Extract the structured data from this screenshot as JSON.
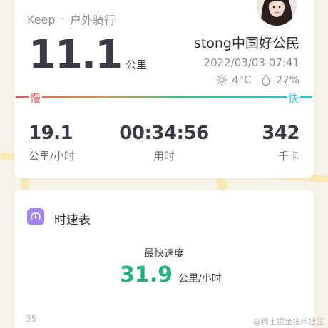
{
  "header": {
    "brand": "Keep",
    "separator": "·",
    "activity": "户外骑行"
  },
  "summary": {
    "distance": "11.1",
    "distance_unit": "公里",
    "username": "stong中国好公民",
    "datetime": "2022/03/03 07:41",
    "temperature": "4°C",
    "humidity": "27%"
  },
  "speed_legend": {
    "slow": "慢",
    "fast": "快"
  },
  "stats": [
    {
      "value": "19.1",
      "label": "公里/小时"
    },
    {
      "value": "00:34:56",
      "label": "用时"
    },
    {
      "value": "342",
      "label": "千卡"
    }
  ],
  "speedometer": {
    "title": "时速表",
    "fastest_label": "最快速度",
    "fastest_value": "31.9",
    "fastest_unit": "公里/小时",
    "axis_tick": "35"
  },
  "watermark": "@稀土掘金技术社区",
  "colors": {
    "accent_green": "#23b27a",
    "slow_red": "#e05a5a",
    "fast_cyan": "#2ec5d9",
    "icon_purple": "#9f86e8"
  },
  "icons": [
    "sun-icon",
    "humidity-drop-icon",
    "speedometer-icon",
    "avatar"
  ]
}
